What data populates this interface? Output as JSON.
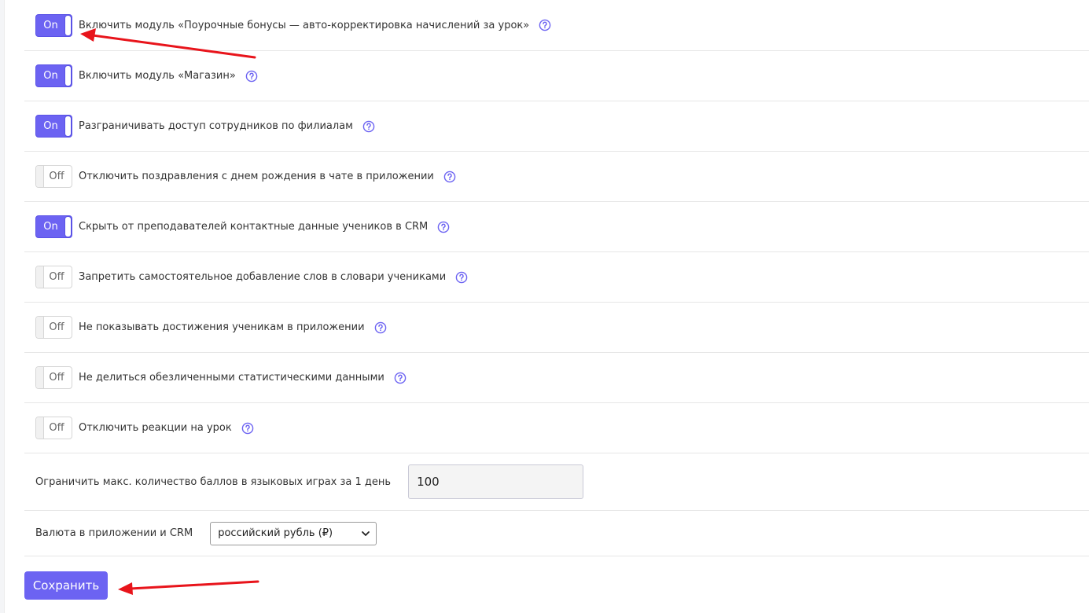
{
  "colors": {
    "accent": "#6c63f2",
    "annotation_arrow": "#e8141b"
  },
  "settings": [
    {
      "label": "Включить модуль «Поурочные бонусы — авто-корректировка начислений за урок»",
      "state": "On",
      "enabled": true,
      "icon": "help-circle-icon"
    },
    {
      "label": "Включить модуль «Магазин»",
      "state": "On",
      "enabled": true,
      "icon": "help-circle-icon"
    },
    {
      "label": "Разграничивать доступ сотрудников по филиалам",
      "state": "On",
      "enabled": true,
      "icon": "help-circle-icon"
    },
    {
      "label": "Отключить поздравления с днем рождения в чате в приложении",
      "state": "Off",
      "enabled": false,
      "icon": "help-circle-icon"
    },
    {
      "label": "Скрыть от преподавателей контактные данные учеников в CRM",
      "state": "On",
      "enabled": true,
      "icon": "help-circle-icon"
    },
    {
      "label": "Запретить самостоятельное добавление слов в словари учениками",
      "state": "Off",
      "enabled": false,
      "icon": "help-circle-icon"
    },
    {
      "label": "Не показывать достижения ученикам в приложении",
      "state": "Off",
      "enabled": false,
      "icon": "help-circle-icon"
    },
    {
      "label": "Не делиться обезличенными статистическими данными",
      "state": "Off",
      "enabled": false,
      "icon": "help-circle-icon"
    },
    {
      "label": "Отключить реакции на урок",
      "state": "Off",
      "enabled": false,
      "icon": "help-circle-icon"
    }
  ],
  "max_points": {
    "label": "Ограничить макс. количество баллов в языковых играх за 1 день",
    "value": "100"
  },
  "currency": {
    "label": "Валюта в приложении и CRM",
    "selected": "российский рубль (₽)"
  },
  "save_label": "Сохранить"
}
